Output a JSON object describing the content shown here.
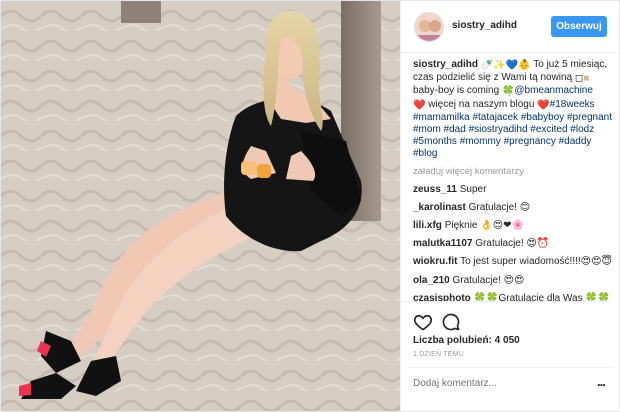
{
  "post": {
    "username": "siostry_adihd",
    "follow_label": "Obserwuj",
    "caption_username": "siostry_adihd",
    "caption_parts": [
      {
        "text": "To już 5 miesiąc, czas podzielić się z Wami tą nowiną ",
        "kind": "text"
      },
      {
        "text": " baby-boy is coming ",
        "kind": "text"
      },
      {
        "text": "@bmeanmachine",
        "kind": "tag"
      },
      {
        "text": " więcej na naszym blogu ",
        "kind": "text"
      },
      {
        "text": "#18weeks #mamamilka #tatajacek #babyboy #pregnant #mom #dad #siostryadihd #excited #lodz #5months #mommy #pregnancy #daddy #blog",
        "kind": "tag"
      }
    ],
    "load_more": "załaduj więcej komentarzy",
    "comments": [
      {
        "user": "zeuss_11",
        "text": "Super"
      },
      {
        "user": "_karolinast",
        "text": "Gratulacje! 😊"
      },
      {
        "user": "lili.xfg",
        "text": "Pięknie 👌😍❤🌸"
      },
      {
        "user": "malutka1107",
        "text": "Gratulacje! 😍⏰"
      },
      {
        "user": "wiokru.fit",
        "text": "To jest super wiadomość!!!!😍😍😇"
      },
      {
        "user": "ola_210",
        "text": "Gratulacje! 😍😍"
      },
      {
        "user": "czasisphoto",
        "text": "🍀🍀Gratulacje dla Was 🍀🍀"
      }
    ],
    "likes": "Liczba polubień: 4 050",
    "time": "1 DZIEŃ TEMU",
    "add_comment_placeholder": "Dodaj komentarz...",
    "more_options": "..."
  },
  "icons": {
    "like": "heart-icon",
    "comment": "speech-bubble-icon",
    "more": "more-options-icon"
  },
  "colors": {
    "accent": "#3897f0",
    "hashtag": "#003569",
    "muted": "#999999"
  }
}
